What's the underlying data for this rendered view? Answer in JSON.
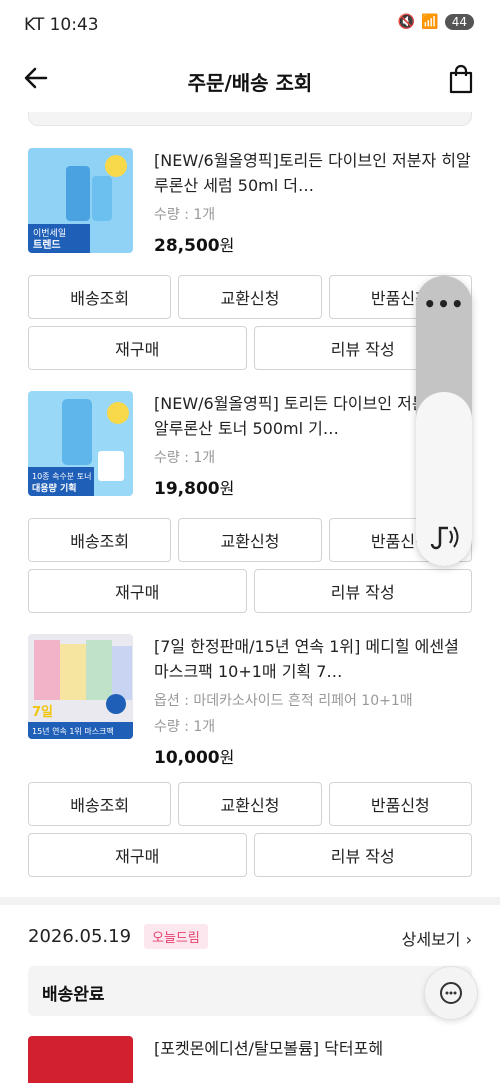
{
  "status_bar": {
    "carrier": "KT 10:43",
    "battery": "44"
  },
  "header": {
    "title": "주문/배송 조회"
  },
  "products": [
    {
      "name": "[NEW/6월올영픽]토리든 다이브인 저분자 히알루론산 세럼 50ml 더…",
      "option": "",
      "qty": "수량 : 1개",
      "price": "28,500",
      "won": "원",
      "thumb_text": "이번세일 트렌드",
      "buttons": [
        "배송조회",
        "교환신청",
        "반품신청"
      ],
      "buttons2": [
        "재구매",
        "리뷰 작성"
      ]
    },
    {
      "name": "[NEW/6월올영픽] 토리든 다이브인 저분자 히알루론산 토너 500ml 기…",
      "option": "",
      "qty": "수량 : 1개",
      "price": "19,800",
      "won": "원",
      "thumb_text": "10종 속수분 토너 대용량 기획",
      "buttons": [
        "배송조회",
        "교환신청",
        "반품신청"
      ],
      "buttons2": [
        "재구매",
        "리뷰 작성"
      ]
    },
    {
      "name": "[7일 한정판매/15년 연속 1위] 메디힐 에센셜 마스크팩 10+1매 기획 7…",
      "option": "옵션 : 마데카소사이드 흔적 리페어 10+1매",
      "qty": "수량 : 1개",
      "price": "10,000",
      "won": "원",
      "thumb_text": "15년 연속 1위 마스크팩",
      "buttons": [
        "배송조회",
        "교환신청",
        "반품신청"
      ],
      "buttons2": [
        "재구매",
        "리뷰 작성"
      ]
    }
  ],
  "next_order": {
    "date": "2026.05.19",
    "badge": "오늘드림",
    "detail_link": "상세보기 ›",
    "delivery_status": "배송완료",
    "product_name": "[포켓몬에디션/탈모볼륨] 닥터포헤"
  },
  "volume": {
    "level": 0.6
  },
  "colors": {
    "accent": "#e6406c",
    "border": "#d3d3d3"
  }
}
